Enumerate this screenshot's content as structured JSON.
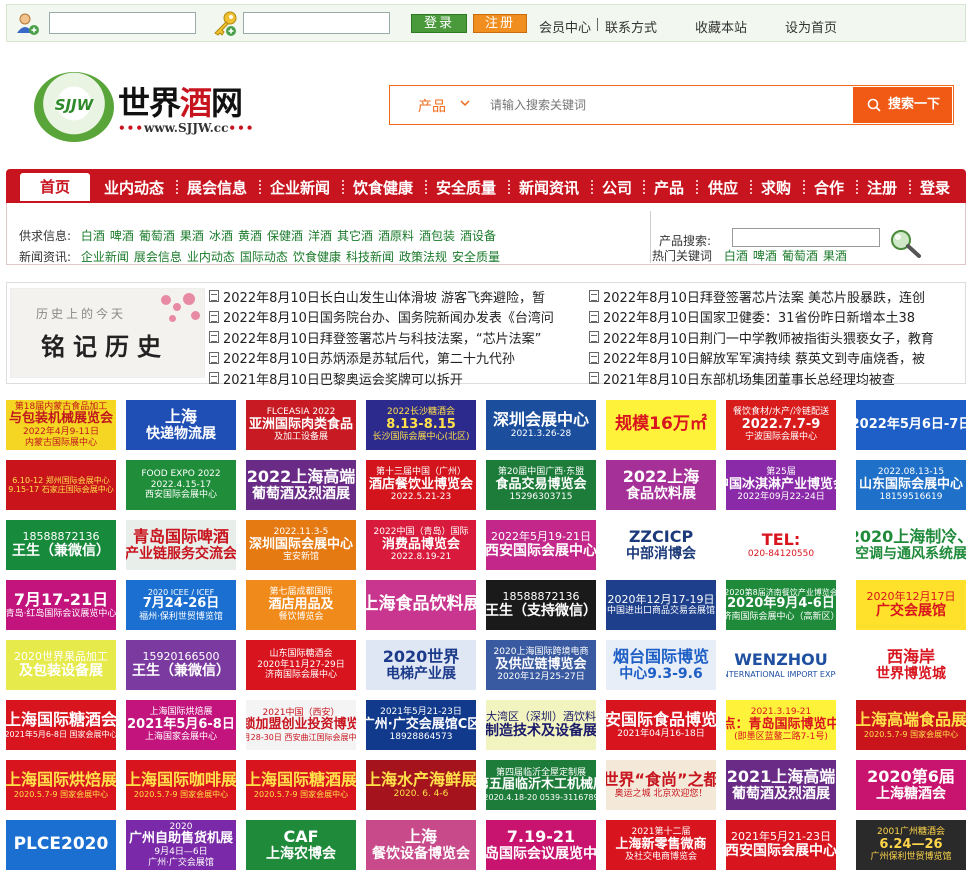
{
  "topbar": {
    "login_label": "登录",
    "register_label": "注册",
    "links": [
      "会员中心",
      "联系方式",
      "收藏本站",
      "设为首页"
    ]
  },
  "logo": {
    "badge": "SJJW",
    "name_a": "世界",
    "name_b": "酒",
    "name_c": "网",
    "url": "www.SJJW.cc"
  },
  "search": {
    "category": "产品",
    "placeholder": "请输入搜索关键词",
    "button": "搜索一下"
  },
  "nav": {
    "home": "首页",
    "items": [
      "业内动态",
      "展会信息",
      "企业新闻",
      "饮食健康",
      "安全质量",
      "新闻资讯",
      "公司",
      "产品",
      "供应",
      "求购",
      "合作",
      "注册",
      "登录"
    ]
  },
  "subnav": {
    "supply_label": "供求信息:",
    "supply": [
      "白酒",
      "啤酒",
      "葡萄酒",
      "果酒",
      "冰酒",
      "黄酒",
      "保健酒",
      "洋酒",
      "其它酒",
      "酒原料",
      "酒包装",
      "酒设备"
    ],
    "news_label": "新闻资讯:",
    "news": [
      "企业新闻",
      "展会信息",
      "业内动态",
      "国际动态",
      "饮食健康",
      "科技新闻",
      "政策法规",
      "安全质量"
    ],
    "product_search_label": "产品搜索:",
    "hot_label": "热门关键词",
    "hot": [
      "白酒",
      "啤酒",
      "葡萄酒",
      "果酒"
    ]
  },
  "banner": {
    "small": "历史上的今天",
    "big": "铭记历史"
  },
  "news_left": [
    "2022年8月10日长白山发生山体滑坡 游客飞奔避险，暂",
    "2022年8月10日国务院台办、国务院新闻办发表《台湾问",
    "2022年8月10日拜登签署芯片与科技法案，“芯片法案”",
    "2022年8月10日苏炳添是苏轼后代，第二十九代孙",
    "2021年8月10日巴黎奥运会奖牌可以拆开"
  ],
  "news_right": [
    "2022年8月10日拜登签署芯片法案 美芯片股暴跌，连创",
    "2022年8月10日国家卫健委：31省份昨日新增本土38",
    "2022年8月10日荆门一中学教师被指街头猥亵女子，教育",
    "2022年8月10日解放军军演持续 蔡英文到寺庙烧香，被",
    "2021年8月10日东部机场集团董事长总经理均被查"
  ],
  "ads": [
    [
      {
        "lines": [
          "第18届内蒙古食品加工",
          "与包装机械展览会",
          "2022年4月9-11日",
          "内蒙古国际展中心"
        ],
        "bg": "#f5d623",
        "fg": "#c0171e"
      },
      {
        "lines": [
          "上海",
          "快递物流展"
        ],
        "bg": "#1f4fb4",
        "fg": "#ffffff"
      },
      {
        "lines": [
          "FLCEASIA 2022",
          "亚洲国际肉类食品",
          "及加工设备展"
        ],
        "bg": "#c71a22",
        "fg": "#ffffff"
      },
      {
        "lines": [
          "2022长沙糖酒会",
          "8.13-8.15",
          "长沙国际会展中心(北区)"
        ],
        "bg": "#2c2a8c",
        "fg": "#ffe14a"
      },
      {
        "lines": [
          "深圳会展中心",
          "2021.3.26-28"
        ],
        "bg": "#1b4f9e",
        "fg": "#ffffff"
      },
      {
        "lines": [
          "规模16万㎡"
        ],
        "bg": "#fff23a",
        "fg": "#d8141e"
      },
      {
        "lines": [
          "餐饮食材/水产/冷链配送",
          "2022.7.7-9",
          "宁波国际会展中心"
        ],
        "bg": "#d81c1c",
        "fg": "#ffffff"
      },
      {
        "lines": [
          "2022年5月6日-7日"
        ],
        "bg": "#1d5fc6",
        "fg": "#ffffff"
      }
    ],
    [
      {
        "lines": [
          "6.10-12 郑州国际会展中心",
          "9.15-17 石家庄国际会展中心"
        ],
        "bg": "#c9141c",
        "fg": "#ffe14a"
      },
      {
        "lines": [
          "FOOD EXPO 2022",
          "2022.4.15-17",
          "西安国际会展中心"
        ],
        "bg": "#1f8d3a",
        "fg": "#ffffff"
      },
      {
        "lines": [
          "2022上海高端",
          "葡萄酒及烈酒展"
        ],
        "bg": "#6a2b86",
        "fg": "#ffffff"
      },
      {
        "lines": [
          "第十三届中国（广州）",
          "酒店餐饮业博览会",
          "2022.5.21-23"
        ],
        "bg": "#d4141c",
        "fg": "#ffffff"
      },
      {
        "lines": [
          "第20届中国广西·东盟",
          "食品交易博览会",
          "15296303715"
        ],
        "bg": "#1e7c3a",
        "fg": "#ffffff"
      },
      {
        "lines": [
          "2022上海",
          "食品饮料展"
        ],
        "bg": "#a53097",
        "fg": "#ffffff"
      },
      {
        "lines": [
          "第25届",
          "中国冰淇淋产业博览会",
          "2022年09月22-24日"
        ],
        "bg": "#8b2aa8",
        "fg": "#ffffff"
      },
      {
        "lines": [
          "2022.08.13-15",
          "山东国际会展中心",
          "18159516619"
        ],
        "bg": "#1e70c8",
        "fg": "#ffffff"
      }
    ],
    [
      {
        "lines": [
          "18588872136",
          "王生（兼微信）"
        ],
        "bg": "#178a3c",
        "fg": "#ffffff"
      },
      {
        "lines": [
          "青岛国际啤酒",
          "产业链服务交流会"
        ],
        "bg": "#e8eeea",
        "fg": "#c8141e"
      },
      {
        "lines": [
          "2022.11.3-5",
          "深圳国际会展中心",
          "宝安新馆"
        ],
        "bg": "#e57a12",
        "fg": "#ffffff"
      },
      {
        "lines": [
          "2022中国（青岛）国际",
          "消费品博览会",
          "2022.8.19-21"
        ],
        "bg": "#d81b3c",
        "fg": "#ffffff"
      },
      {
        "lines": [
          "2022年5月19-21日",
          "西安国际会展中心"
        ],
        "bg": "#c3278a",
        "fg": "#ffffff"
      },
      {
        "lines": [
          "ZZCICP",
          "中部消博会"
        ],
        "bg": "#ffffff",
        "fg": "#1c3a7a"
      },
      {
        "lines": [
          "TEL:",
          "020-84120550"
        ],
        "bg": "#ffffff",
        "fg": "#d8141e"
      },
      {
        "lines": [
          "2020上海制冷、",
          "空调与通风系统展"
        ],
        "bg": "#ffffff",
        "fg": "#1e8a3a"
      }
    ],
    [
      {
        "lines": [
          "7月17-21日",
          "青岛·红岛国际会议展览中心"
        ],
        "bg": "#c3147e",
        "fg": "#ffffff"
      },
      {
        "lines": [
          "2020 ICEE / ICEF",
          "7月24-26日",
          "福州·保利世贸博览馆"
        ],
        "bg": "#1a6fd0",
        "fg": "#ffffff"
      },
      {
        "lines": [
          "第七届成都国际",
          "酒店用品及",
          "餐饮博览会"
        ],
        "bg": "#f08a1a",
        "fg": "#ffffff"
      },
      {
        "lines": [
          "上海食品饮料展"
        ],
        "bg": "#c8368f",
        "fg": "#ffffff"
      },
      {
        "lines": [
          "18588872136",
          "王生（支持微信）"
        ],
        "bg": "#1a1a1a",
        "fg": "#ffffff"
      },
      {
        "lines": [
          "2020年12月17-19日",
          "中国进出口商品交易会展馆"
        ],
        "bg": "#1d3f8c",
        "fg": "#ffffff"
      },
      {
        "lines": [
          "2020第8届济南餐饮产业博览会",
          "2020年9月4-6日",
          "济南国际会展中心（高新区）"
        ],
        "bg": "#1e8a3a",
        "fg": "#ffffff"
      },
      {
        "lines": [
          "2020年12月17日",
          "广交会展馆"
        ],
        "bg": "#ffe02a",
        "fg": "#d8141e"
      }
    ],
    [
      {
        "lines": [
          "2020世界果品加工",
          "及包装设备展"
        ],
        "bg": "#e6ea4a",
        "fg": "#ffffff"
      },
      {
        "lines": [
          "15920166500",
          "王生（兼微信）"
        ],
        "bg": "#7a3aa0",
        "fg": "#ffffff"
      },
      {
        "lines": [
          "山东国际糖酒会",
          "2020年11月27-29日",
          "济南国际会展中心"
        ],
        "bg": "#d8141e",
        "fg": "#ffffff"
      },
      {
        "lines": [
          "2020世界",
          "电梯产业展"
        ],
        "bg": "#dfe6f4",
        "fg": "#1c3a8a"
      },
      {
        "lines": [
          "2020上海国际跨境电商",
          "及供应链博览会",
          "2020年12月25-27日"
        ],
        "bg": "#395aa0",
        "fg": "#ffffff"
      },
      {
        "lines": [
          "烟台国际博览",
          "中心9.3-9.6"
        ],
        "bg": "#e8eef8",
        "fg": "#1e5fc6"
      },
      {
        "lines": [
          "WENZHOU",
          "INTERNATIONAL IMPORT EXPO"
        ],
        "bg": "#ffffff",
        "fg": "#1e4fa0"
      },
      {
        "lines": [
          "西海岸",
          "世界博览城"
        ],
        "bg": "#ffffff",
        "fg": "#d8141e"
      }
    ],
    [
      {
        "lines": [
          "上海国际糖酒会",
          "2021年5月6-8日 国家会展中心"
        ],
        "bg": "#d8141e",
        "fg": "#ffffff"
      },
      {
        "lines": [
          "上海国际烘焙展",
          "2021年5月6-8日",
          "上海国家会展中心"
        ],
        "bg": "#c3147e",
        "fg": "#ffffff"
      },
      {
        "lines": [
          "2021中国（西安）",
          "连锁加盟创业投资博览会",
          "5月28-30日 西安曲江国际会展中心"
        ],
        "bg": "#f4f4f4",
        "fg": "#c8141e"
      },
      {
        "lines": [
          "2021年5月21-23日",
          "广州·广交会展馆C区",
          "18928864573"
        ],
        "bg": "#123a8c",
        "fg": "#ffffff"
      },
      {
        "lines": [
          "大湾区（深圳）酒饮料",
          "制造技术及设备展"
        ],
        "bg": "#f2f4c0",
        "fg": "#1a1a6a"
      },
      {
        "lines": [
          "西安国际食品博览会",
          "2021年04月16-18日"
        ],
        "bg": "#d8141e",
        "fg": "#ffffff"
      },
      {
        "lines": [
          "2021.3.19-21",
          "地点：青岛国际博览中心",
          "(即墨区蓝鳌二路7-1号)"
        ],
        "bg": "#fff23a",
        "fg": "#d8141e"
      },
      {
        "lines": [
          "上海高端食品展",
          "2020.5.7-9 国家会展中心"
        ],
        "bg": "#c9141c",
        "fg": "#ffe14a"
      }
    ],
    [
      {
        "lines": [
          "上海国际烘焙展",
          "2020.5.7-9 国家会展中心"
        ],
        "bg": "#d8141e",
        "fg": "#ffe14a"
      },
      {
        "lines": [
          "上海国际咖啡展",
          "2020.5.7-9 国家会展中心"
        ],
        "bg": "#d8141e",
        "fg": "#ffe14a"
      },
      {
        "lines": [
          "上海国际糖酒展",
          "2020.5.7-9 国家会展中心"
        ],
        "bg": "#d8141e",
        "fg": "#ffe14a"
      },
      {
        "lines": [
          "上海水产海鲜展",
          "2020. 6. 4-6"
        ],
        "bg": "#a5141c",
        "fg": "#ffe14a"
      },
      {
        "lines": [
          "第四届临沂全屋定制展",
          "第五届临沂木工机械展",
          "2020.4.18-20 0539-3116789"
        ],
        "bg": "#1e7c3a",
        "fg": "#ffffff"
      },
      {
        "lines": [
          "世界“食尚”之都",
          "奥运之城  北京欢迎您！"
        ],
        "bg": "#f4e8d8",
        "fg": "#c8141e"
      },
      {
        "lines": [
          "2021上海高端",
          "葡萄酒及烈酒展"
        ],
        "bg": "#6a2b86",
        "fg": "#ffffff"
      },
      {
        "lines": [
          "2020第6届",
          "上海糖酒会"
        ],
        "bg": "#c8146e",
        "fg": "#ffffff"
      }
    ],
    [
      {
        "lines": [
          "PLCE2020"
        ],
        "bg": "#1a6fd0",
        "fg": "#ffffff"
      },
      {
        "lines": [
          "2020",
          "广州自助售货机展",
          "9月4日—6日",
          "广州·广交会展馆"
        ],
        "bg": "#7a2aa8",
        "fg": "#ffffff"
      },
      {
        "lines": [
          "CAF",
          "上海农博会"
        ],
        "bg": "#1e8a3a",
        "fg": "#ffffff"
      },
      {
        "lines": [
          "上海",
          "餐饮设备博览会"
        ],
        "bg": "#c84a8a",
        "fg": "#ffffff"
      },
      {
        "lines": [
          "7.19-21",
          "红岛国际会议展览中心"
        ],
        "bg": "#c8146e",
        "fg": "#ffffff"
      },
      {
        "lines": [
          "2021第十二届",
          "上海新零售微商",
          "及社交电商博览会"
        ],
        "bg": "#d8141e",
        "fg": "#ffffff"
      },
      {
        "lines": [
          "2021年5月21-23日",
          "西安国际会展中心"
        ],
        "bg": "#d8141e",
        "fg": "#ffffff"
      },
      {
        "lines": [
          "2001广州糖酒会",
          "6.24—26",
          "广州保利世贸博览馆"
        ],
        "bg": "#2a2a2a",
        "fg": "#ffd54a"
      }
    ]
  ],
  "colors": {
    "brand_red": "#c8141e",
    "brand_green": "#5aa53a",
    "search_orange": "#f05a14",
    "link_green": "#1a7a2a"
  }
}
